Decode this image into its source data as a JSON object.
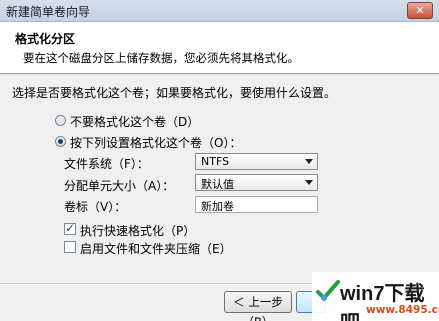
{
  "window": {
    "title": "新建简单卷向导",
    "close_label": "✕"
  },
  "header": {
    "title": "格式化分区",
    "description": "要在这个磁盘分区上储存数据，您必须先将其格式化。"
  },
  "question": "选择是否要格式化这个卷；如果要格式化，要使用什么设置。",
  "options": {
    "no_format": {
      "label": "不要格式化这个卷（D）",
      "selected": false
    },
    "format": {
      "label": "按下列设置格式化这个卷（O）：",
      "selected": true
    }
  },
  "fields": {
    "file_system": {
      "label": "文件系统（F）：",
      "value": "NTFS"
    },
    "allocation_unit": {
      "label": "分配单元大小（A）：",
      "value": "默认值"
    },
    "volume_label": {
      "label": "卷标（V）：",
      "value": "新加卷"
    }
  },
  "checkboxes": {
    "quick_format": {
      "label": "执行快速格式化（P）",
      "checked": true
    },
    "compression": {
      "label": "启用文件和文件夹压缩（E）",
      "checked": false
    }
  },
  "buttons": {
    "back": "＜ 上一步（B）"
  },
  "watermark": {
    "brand": "win7下载吧",
    "url": "www.8495.cn"
  }
}
